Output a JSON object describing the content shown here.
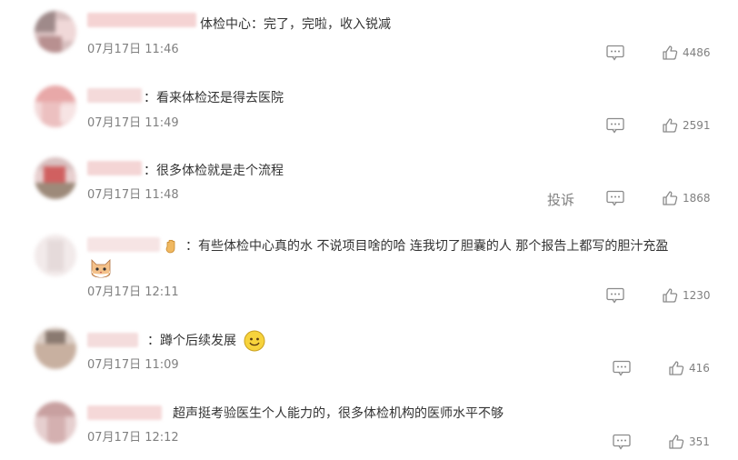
{
  "comments": [
    {
      "text": "体检中心：完了，完啦，收入锐减",
      "time": "07月17日 11:46",
      "likes": "4486"
    },
    {
      "text": "：看来体检还是得去医院",
      "time": "07月17日 11:49",
      "likes": "2591"
    },
    {
      "text": "：很多体检就是走个流程",
      "time": "07月17日 11:48",
      "likes": "1868",
      "report": "投诉"
    },
    {
      "text": "：有些体检中心真的水 不说项目啥的哈 连我切了胆囊的人 那个报告上都写的胆汁充盈",
      "time": "07月17日 12:11",
      "likes": "1230"
    },
    {
      "text": "：蹲个后续发展",
      "time": "07月17日 11:09",
      "likes": "416"
    },
    {
      "text": "超声挺考验医生个人能力的，很多体检机构的医师水平不够",
      "time": "07月17日 12:12",
      "likes": "351"
    }
  ],
  "icons": {
    "reply": "comment-icon",
    "like": "thumbs-up-icon",
    "emoji": "smile-emoji-icon",
    "sticker": "cat-sticker-icon",
    "hand": "hand-icon"
  },
  "colors": {
    "text": "#333333",
    "meta": "#808080"
  }
}
